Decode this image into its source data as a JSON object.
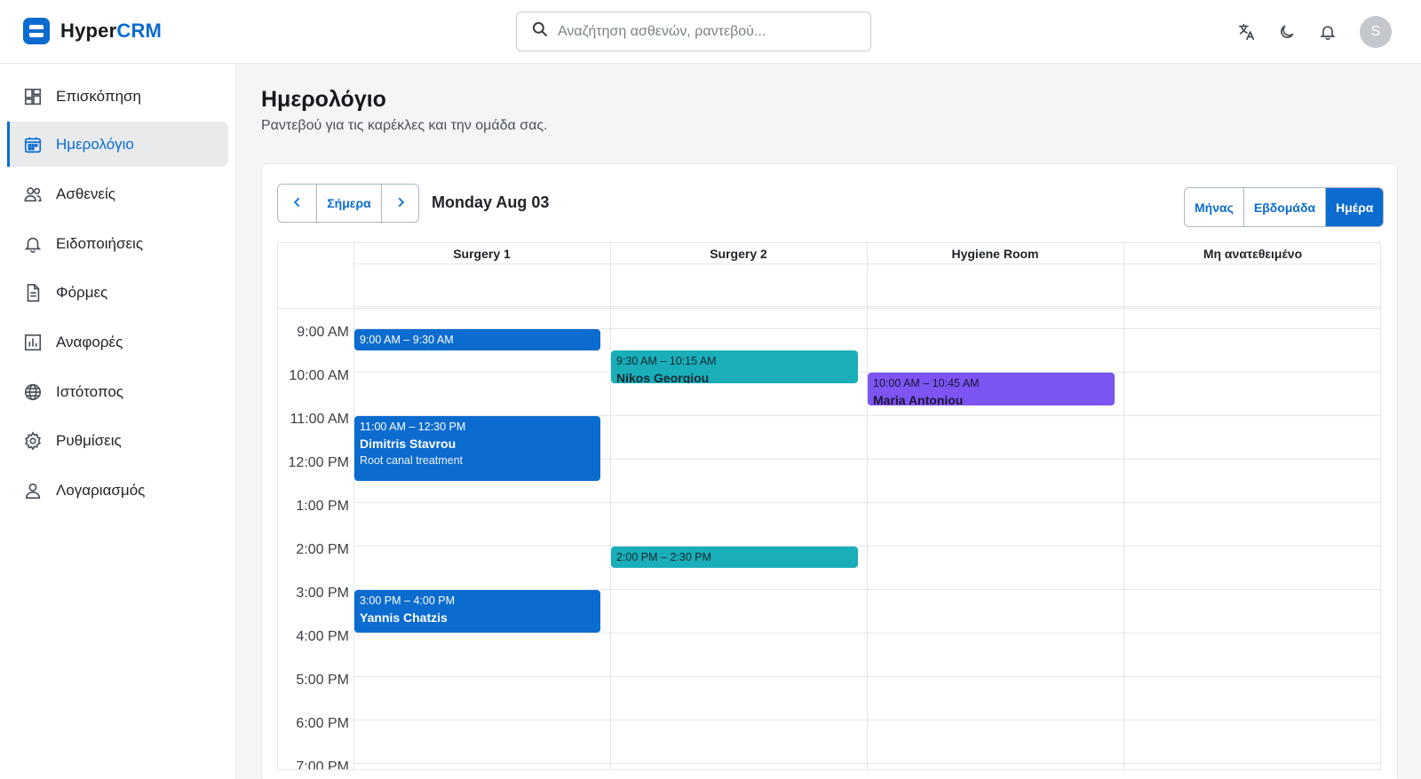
{
  "app": {
    "name_part1": "Hyper",
    "name_part2": "CRM"
  },
  "search": {
    "placeholder": "Αναζήτηση ασθενών, ραντεβού..."
  },
  "header_icons": [
    "translate-icon",
    "moon-icon",
    "bell-icon"
  ],
  "user": {
    "avatar_initial": "S"
  },
  "sidebar": {
    "items": [
      {
        "label": "Επισκόπηση",
        "icon": "dashboard-icon"
      },
      {
        "label": "Ημερολόγιο",
        "icon": "calendar-icon",
        "active": true
      },
      {
        "label": "Ασθενείς",
        "icon": "people-icon"
      },
      {
        "label": "Ειδοποιήσεις",
        "icon": "bell-icon"
      },
      {
        "label": "Φόρμες",
        "icon": "document-icon"
      },
      {
        "label": "Αναφορές",
        "icon": "chart-icon"
      },
      {
        "label": "Ιστότοπος",
        "icon": "globe-icon"
      },
      {
        "label": "Ρυθμίσεις",
        "icon": "gear-icon"
      },
      {
        "label": "Λογαριασμός",
        "icon": "person-icon"
      }
    ]
  },
  "page": {
    "title": "Ημερολόγιο",
    "subtitle": "Ραντεβού για τις καρέκλες και την ομάδα σας."
  },
  "toolbar": {
    "prev": "‹",
    "today_label": "Σήμερα",
    "next": "›",
    "date_label": "Monday Aug 03",
    "views": [
      {
        "label": "Μήνας",
        "active": false
      },
      {
        "label": "Εβδομάδα",
        "active": false
      },
      {
        "label": "Ημέρα",
        "active": true
      }
    ]
  },
  "calendar": {
    "columns": [
      "Surgery 1",
      "Surgery 2",
      "Hygiene Room",
      "Μη ανατεθειμένο"
    ],
    "times": [
      "9:00 AM",
      "10:00 AM",
      "11:00 AM",
      "12:00 PM",
      "1:00 PM",
      "2:00 PM",
      "3:00 PM",
      "4:00 PM",
      "5:00 PM",
      "6:00 PM",
      "7:00 PM"
    ],
    "events": [
      {
        "column": "Surgery 1",
        "time": "9:00 AM – 9:30 AM",
        "name": "",
        "description": "",
        "color": "#0b6bcf"
      },
      {
        "column": "Surgery 2",
        "time": "9:30 AM – 10:15 AM",
        "name": "Nikos Georgiou",
        "description": "",
        "color": "#1aaeb9"
      },
      {
        "column": "Hygiene Room",
        "time": "10:00 AM – 10:45 AM",
        "name": "Maria Antoniou",
        "description": "",
        "color": "#7c55f2"
      },
      {
        "column": "Surgery 1",
        "time": "11:00 AM – 12:30 PM",
        "name": "Dimitris Stavrou",
        "description": "Root canal treatment",
        "color": "#0b6bcf"
      },
      {
        "column": "Surgery 2",
        "time": "2:00 PM – 2:30 PM",
        "name": "",
        "description": "",
        "color": "#1aaeb9"
      },
      {
        "column": "Surgery 1",
        "time": "3:00 PM – 4:00 PM",
        "name": "Yannis Chatzis",
        "description": "",
        "color": "#0b6bcf"
      }
    ]
  }
}
